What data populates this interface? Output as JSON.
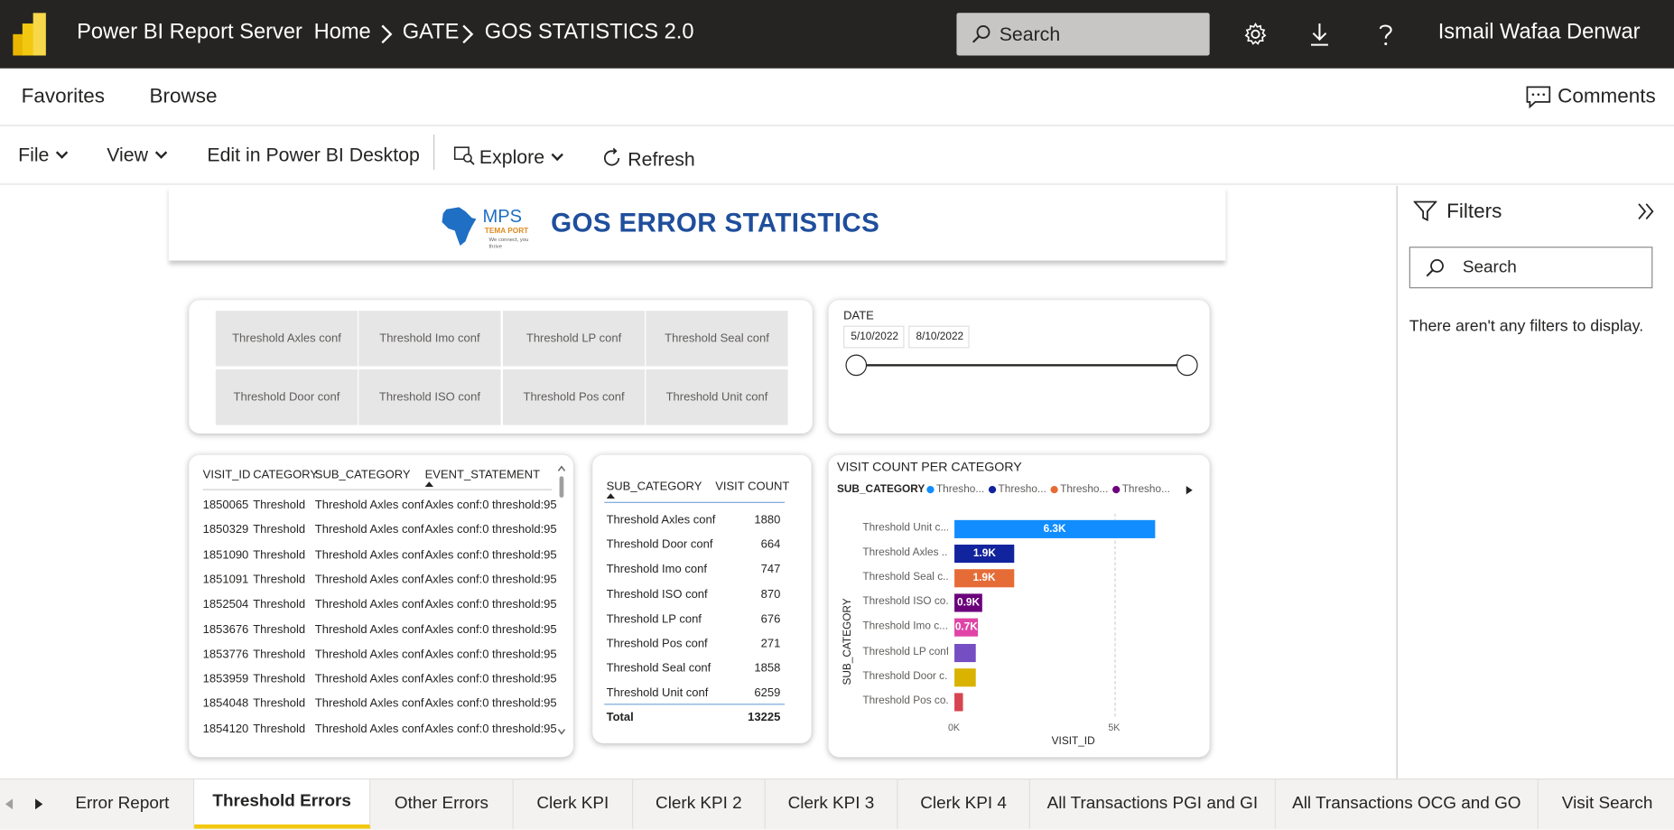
{
  "app": {
    "name": "Power BI Report Server"
  },
  "breadcrumb": {
    "home": "Home",
    "folder": "GATE",
    "report": "GOS STATISTICS 2.0"
  },
  "header": {
    "search_placeholder": "Search",
    "user": "Ismail Wafaa Denwar",
    "icons": [
      "gear-icon",
      "download-icon",
      "help-icon"
    ]
  },
  "nav": {
    "favorites": "Favorites",
    "browse": "Browse",
    "comments": "Comments"
  },
  "toolbar": {
    "file": "File",
    "view": "View",
    "edit": "Edit in Power BI Desktop",
    "explore": "Explore",
    "refresh": "Refresh"
  },
  "report": {
    "logo": {
      "mps": "MPS",
      "sub": "TEMA PORT",
      "tag": "We connect, you thrive"
    },
    "title": "GOS ERROR STATISTICS",
    "slicer_buttons": [
      "Threshold Axles conf",
      "Threshold Imo conf",
      "Threshold LP conf",
      "Threshold Seal conf",
      "Threshold Door conf",
      "Threshold ISO conf",
      "Threshold Pos conf",
      "Threshold Unit conf"
    ],
    "date_slicer": {
      "label": "DATE",
      "start": "5/10/2022",
      "end": "8/10/2022"
    },
    "detail_table": {
      "headers": [
        "VISIT_ID",
        "CATEGORY",
        "SUB_CATEGORY",
        "EVENT_STATEMENT"
      ],
      "rows": [
        [
          "1850065",
          "Threshold",
          "Threshold Axles conf",
          "Axles conf:0 threshold:95"
        ],
        [
          "1850329",
          "Threshold",
          "Threshold Axles conf",
          "Axles conf:0 threshold:95"
        ],
        [
          "1851090",
          "Threshold",
          "Threshold Axles conf",
          "Axles conf:0 threshold:95"
        ],
        [
          "1851091",
          "Threshold",
          "Threshold Axles conf",
          "Axles conf:0 threshold:95"
        ],
        [
          "1852504",
          "Threshold",
          "Threshold Axles conf",
          "Axles conf:0 threshold:95"
        ],
        [
          "1853676",
          "Threshold",
          "Threshold Axles conf",
          "Axles conf:0 threshold:95"
        ],
        [
          "1853776",
          "Threshold",
          "Threshold Axles conf",
          "Axles conf:0 threshold:95"
        ],
        [
          "1853959",
          "Threshold",
          "Threshold Axles conf",
          "Axles conf:0 threshold:95"
        ],
        [
          "1854048",
          "Threshold",
          "Threshold Axles conf",
          "Axles conf:0 threshold:95"
        ],
        [
          "1854120",
          "Threshold",
          "Threshold Axles conf",
          "Axles conf:0 threshold:95"
        ]
      ]
    },
    "summary_table": {
      "headers": [
        "SUB_CATEGORY",
        "VISIT COUNT"
      ],
      "rows": [
        [
          "Threshold Axles conf",
          "1880"
        ],
        [
          "Threshold Door conf",
          "664"
        ],
        [
          "Threshold Imo conf",
          "747"
        ],
        [
          "Threshold ISO conf",
          "870"
        ],
        [
          "Threshold LP conf",
          "676"
        ],
        [
          "Threshold Pos conf",
          "271"
        ],
        [
          "Threshold Seal conf",
          "1858"
        ],
        [
          "Threshold Unit conf",
          "6259"
        ]
      ],
      "total_label": "Total",
      "total_value": "13225"
    }
  },
  "chart_data": {
    "type": "bar",
    "orientation": "horizontal",
    "title": "VISIT COUNT PER CATEGORY",
    "legend_title": "SUB_CATEGORY",
    "legend_entries": [
      "Thresho...",
      "Thresho...",
      "Thresho...",
      "Thresho..."
    ],
    "legend_colors": [
      "#118dff",
      "#12239e",
      "#e66c37",
      "#6b007b"
    ],
    "categories": [
      "Threshold Unit c...",
      "Threshold Axles ...",
      "Threshold Seal c...",
      "Threshold ISO co...",
      "Threshold Imo c...",
      "Threshold LP conf",
      "Threshold Door c...",
      "Threshold Pos co..."
    ],
    "values": [
      6259,
      1880,
      1858,
      870,
      747,
      676,
      664,
      271
    ],
    "data_labels": [
      "6.3K",
      "1.9K",
      "1.9K",
      "0.9K",
      "0.7K",
      "",
      "",
      ""
    ],
    "colors": [
      "#118dff",
      "#12239e",
      "#e66c37",
      "#6b007b",
      "#e044a7",
      "#744ec2",
      "#d9b300",
      "#d64550"
    ],
    "xlabel": "VISIT_ID",
    "ylabel": "SUB_CATEGORY",
    "xticks": [
      "0K",
      "5K"
    ],
    "xlim": [
      0,
      7000
    ]
  },
  "filters": {
    "title": "Filters",
    "search_placeholder": "Search",
    "empty_message": "There aren't any filters to display."
  },
  "tabs": [
    "Error Report",
    "Threshold Errors",
    "Other Errors",
    "Clerk KPI",
    "Clerk KPI 2",
    "Clerk KPI 3",
    "Clerk KPI 4",
    "All Transactions PGI and GI",
    "All Transactions OCG and GO",
    "Visit Search"
  ],
  "active_tab": "Threshold Errors"
}
